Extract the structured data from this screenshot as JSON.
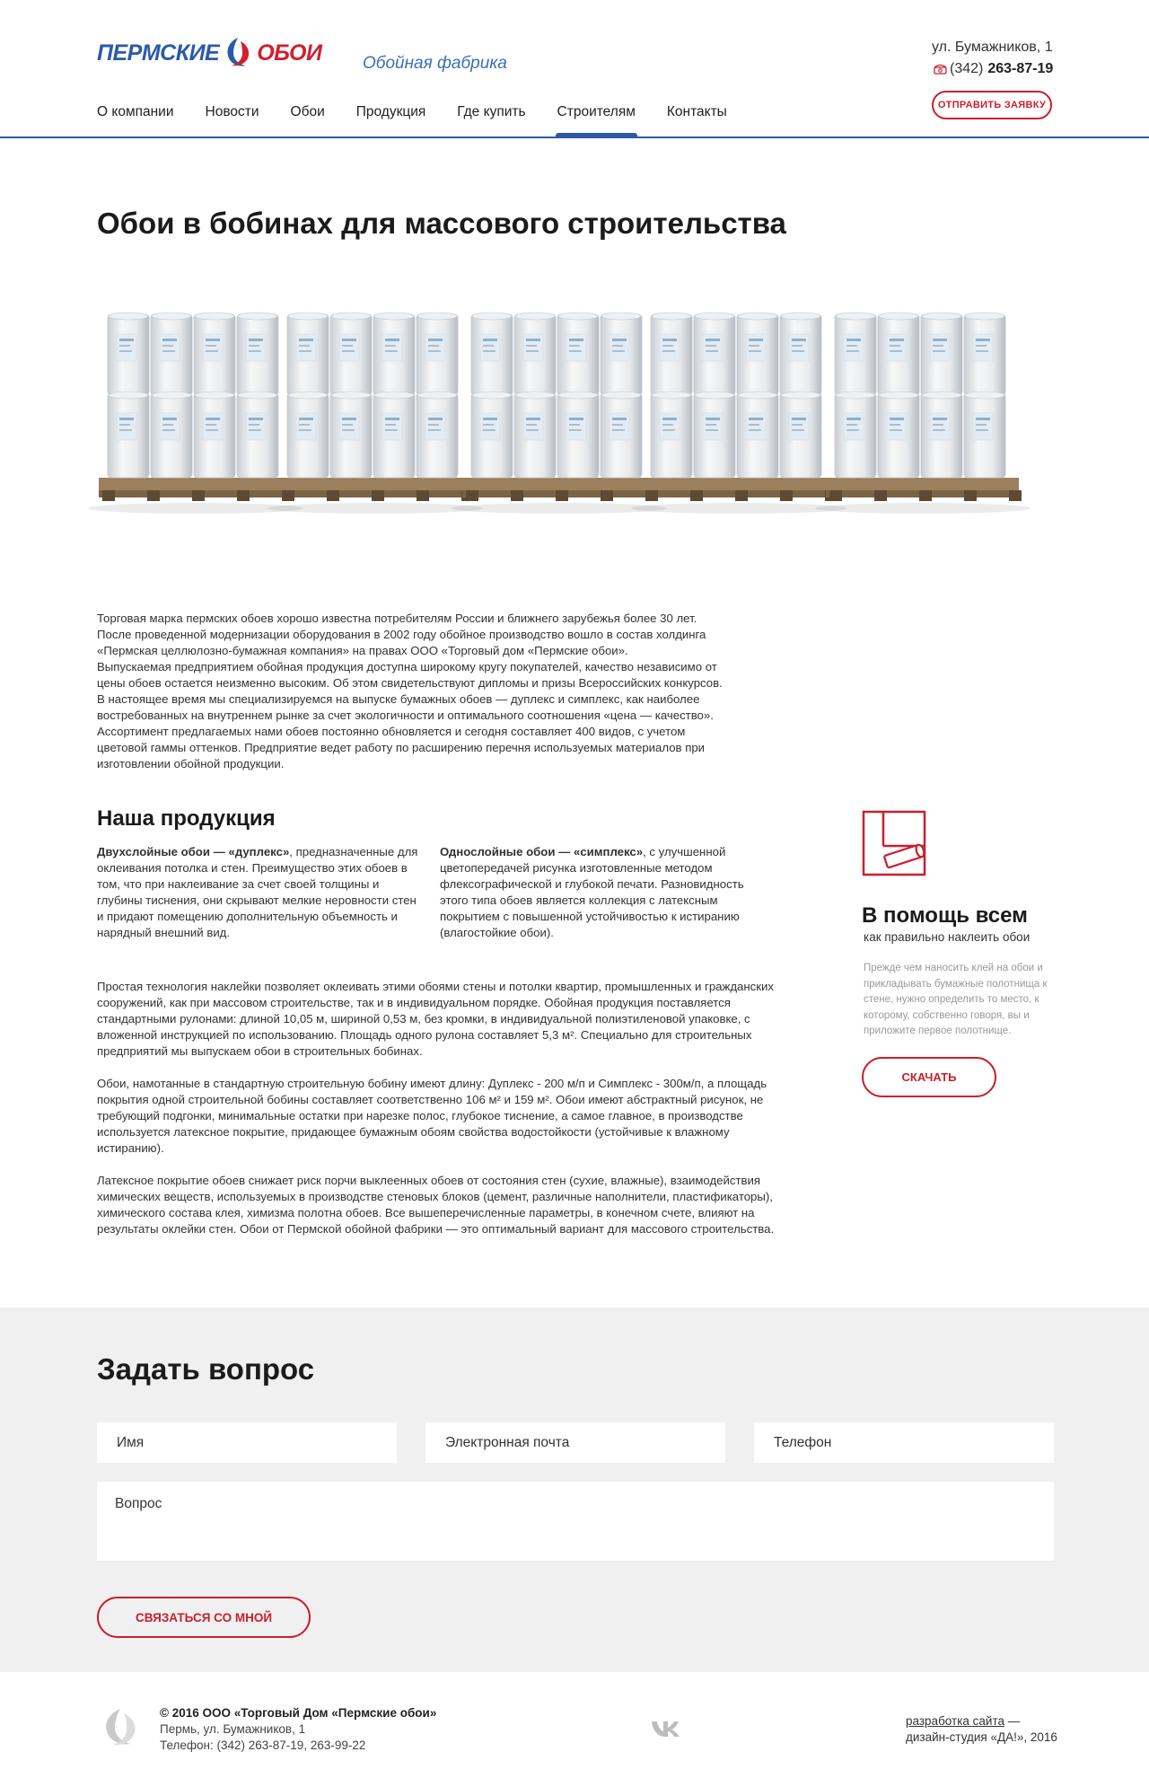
{
  "header": {
    "logo_left": "ПЕРМСКИЕ",
    "logo_right": "ОБОИ",
    "tagline": "Обойная фабрика",
    "address": "ул. Бумажников, 1",
    "phone_code": "(342)",
    "phone_number": "263-87-19",
    "send_label": "ОТПРАВИТЬ ЗАЯВКУ"
  },
  "nav": [
    {
      "label": "О компании"
    },
    {
      "label": "Новости"
    },
    {
      "label": "Обои"
    },
    {
      "label": "Продукция"
    },
    {
      "label": "Где купить"
    },
    {
      "label": "Строителям",
      "active": true
    },
    {
      "label": "Контакты"
    }
  ],
  "page": {
    "title": "Обои в бобинах для массового строительства",
    "intro": [
      "Торговая марка пермских обоев хорошо известна потребителям России и ближнего зарубежья более 30 лет.",
      "После проведенной модернизации оборудования в 2002 году обойное производство вошло в состав холдинга",
      "«Пермская целлюлозно-бумажная компания» на правах ООО «Торговый дом «Пермские обои».",
      "Выпускаемая предприятием обойная продукция доступна широкому кругу покупателей, качество независимо от",
      "цены обоев остается неизменно высоким. Об этом свидетельствуют дипломы и призы Всероссийских конкурсов.",
      "В настоящее время мы специализируемся на выпуске бумажных обоев — дуплекс и симплекс, как наиболее",
      "востребованных на внутреннем рынке за счет экологичности и оптимального соотношения «цена — качество».",
      "Ассортимент предлагаемых нами обоев постоянно обновляется и сегодня составляет 400 видов, с учетом",
      "цветовой гаммы оттенков. Предприятие ведет работу по расширению перечня используемых материалов при",
      "изготовлении обойной продукции."
    ],
    "products_title": "Наша продукция",
    "duplex_bold": "Двухслойные обои — «дуплекс»",
    "duplex_text": ", предназначенные для оклеивания потолка и стен. Преимущество этих обоев в том, что при наклеивание за счет своей толщины и глубины тиснения, они скрывают мелкие неровности стен и придают помещению дополнительную объемность и нарядный внешний вид.",
    "simplex_bold": "Однослойные обои — «симплекс»",
    "simplex_text": ", с улучшенной цветопередачей рисунка изготовленные методом флексографической и глубокой печати. Разновидность этого типа обоев является коллекция с латексным покрытием с повышенной устойчивостью к истиранию (влагостойкие обои).",
    "more_p1": "Простая технология наклейки позволяет оклеивать этими обоями стены и потолки квартир, промышленных и гражданских сооружений, как при массовом строительстве, так и в индивидуальном порядке. Обойная продукция поставляется стандартными рулонами: длиной 10,05 м, шириной 0,53 м, без кромки, в индивидуальной полиэтиленовой упаковке, с вложенной инструкцией по использованию. Площадь одного рулона составляет 5,3 м². Специально для строительных предприятий мы выпускаем обои в строительных бобинах.",
    "more_p2": "Обои, намотанные в стандартную строительную бобину имеют  длину: Дуплекс - 200 м/п и Симплекс - 300м/п, а площадь покрытия одной строительной бобины составляет соответственно 106 м² и 159 м². Обои имеют абстрактный рисунок, не требующий подгонки, минимальные остатки при нарезке полос, глубокое тиснение, а самое главное, в производстве используется латексное покрытие, придающее бумажным обоям свойства водостойкости (устойчивые к влажному истиранию).",
    "more_p3": "Латексное покрытие обоев снижает риск порчи выклеенных обоев от состояния стен (сухие, влажные), взаимодействия химических веществ, используемых в производстве стеновых блоков (цемент, различные наполнители, пластификаторы), химического состава клея, химизма полотна обоев. Все вышеперечисленные параметры, в конечном счете, влияют на результаты оклейки стен. Обои от Пермской обойной фабрики — это оптимальный вариант для массового строительства."
  },
  "sidebar": {
    "title": "В помощь всем",
    "subtitle": "как правильно наклеить обои",
    "text": "Прежде чем наносить клей на обои и прикладывать бумажные полотнища к стене, нужно определить то место, к которому, собственно говоря, вы и приложите первое полотнище.",
    "download_label": "СКАЧАТЬ"
  },
  "question": {
    "title": "Задать вопрос",
    "name_placeholder": "Имя",
    "email_placeholder": "Электронная почта",
    "phone_placeholder": "Телефон",
    "question_placeholder": "Вопрос",
    "submit_label": "СВЯЗАТЬСЯ СО МНОЙ"
  },
  "footer": {
    "copyright": "© 2016 ООО «Торговый Дом «Пермские обои»",
    "address": "Пермь, ул. Бумажников, 1",
    "phones": "Телефон: (342) 263-87-19, 263-99-22",
    "dev_link": "разработка сайта",
    "dev_dash": " —",
    "dev_studio": "дизайн-студия «ДА!», 2016"
  },
  "colors": {
    "brand_blue": "#2c5aa8",
    "brand_red": "#c8202e",
    "question_bg": "#f0f0f0"
  }
}
